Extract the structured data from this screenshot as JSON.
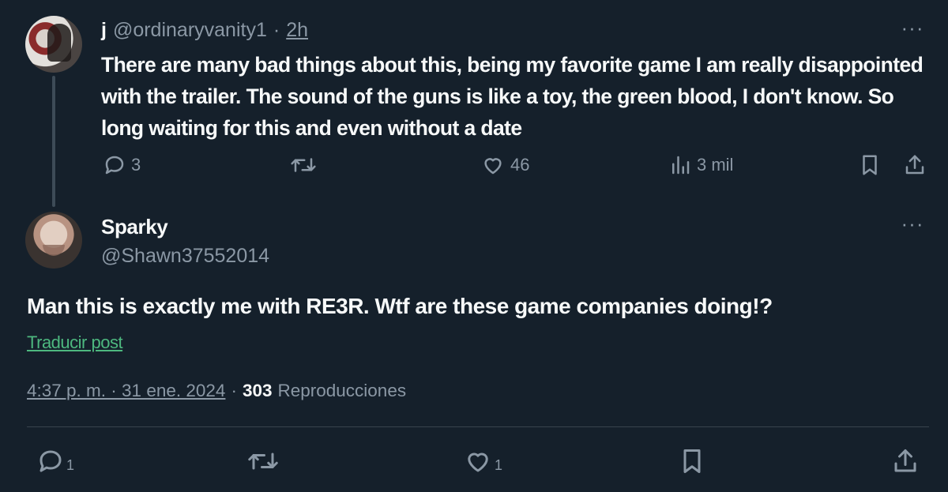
{
  "parent_reply": {
    "display_name": "j",
    "handle": "@ordinaryvanity1",
    "separator": "·",
    "time": "2h",
    "text": "There are many bad things about this, being my favorite game I am really disappointed with the trailer. The sound of the guns is like a toy, the green blood, I don't know. So long waiting for this and even without a date",
    "more_icon": "···",
    "actions": {
      "reply_count": "3",
      "retweet_count": "",
      "like_count": "46",
      "views_count": "3 mil"
    }
  },
  "main_tweet": {
    "display_name": "Sparky",
    "handle": "@Shawn37552014",
    "more_icon": "···",
    "text": "Man this is exactly me with RE3R. Wtf are these game companies doing!?",
    "translate_label": "Traducir post",
    "timestamp": "4:37 p. m. · 31 ene. 2024",
    "separator": "·",
    "views_count": "303",
    "views_label": "Reproducciones",
    "actions": {
      "reply_count": "1",
      "retweet_count": "",
      "like_count": "1"
    }
  },
  "colors": {
    "background": "#15202b",
    "text_primary": "#f7f9f9",
    "text_secondary": "#8b98a5",
    "translate_link": "#4db87f",
    "divider": "#38444d"
  },
  "icons": [
    "reply-icon",
    "retweet-icon",
    "like-icon",
    "views-icon",
    "bookmark-icon",
    "share-icon",
    "more-icon"
  ]
}
